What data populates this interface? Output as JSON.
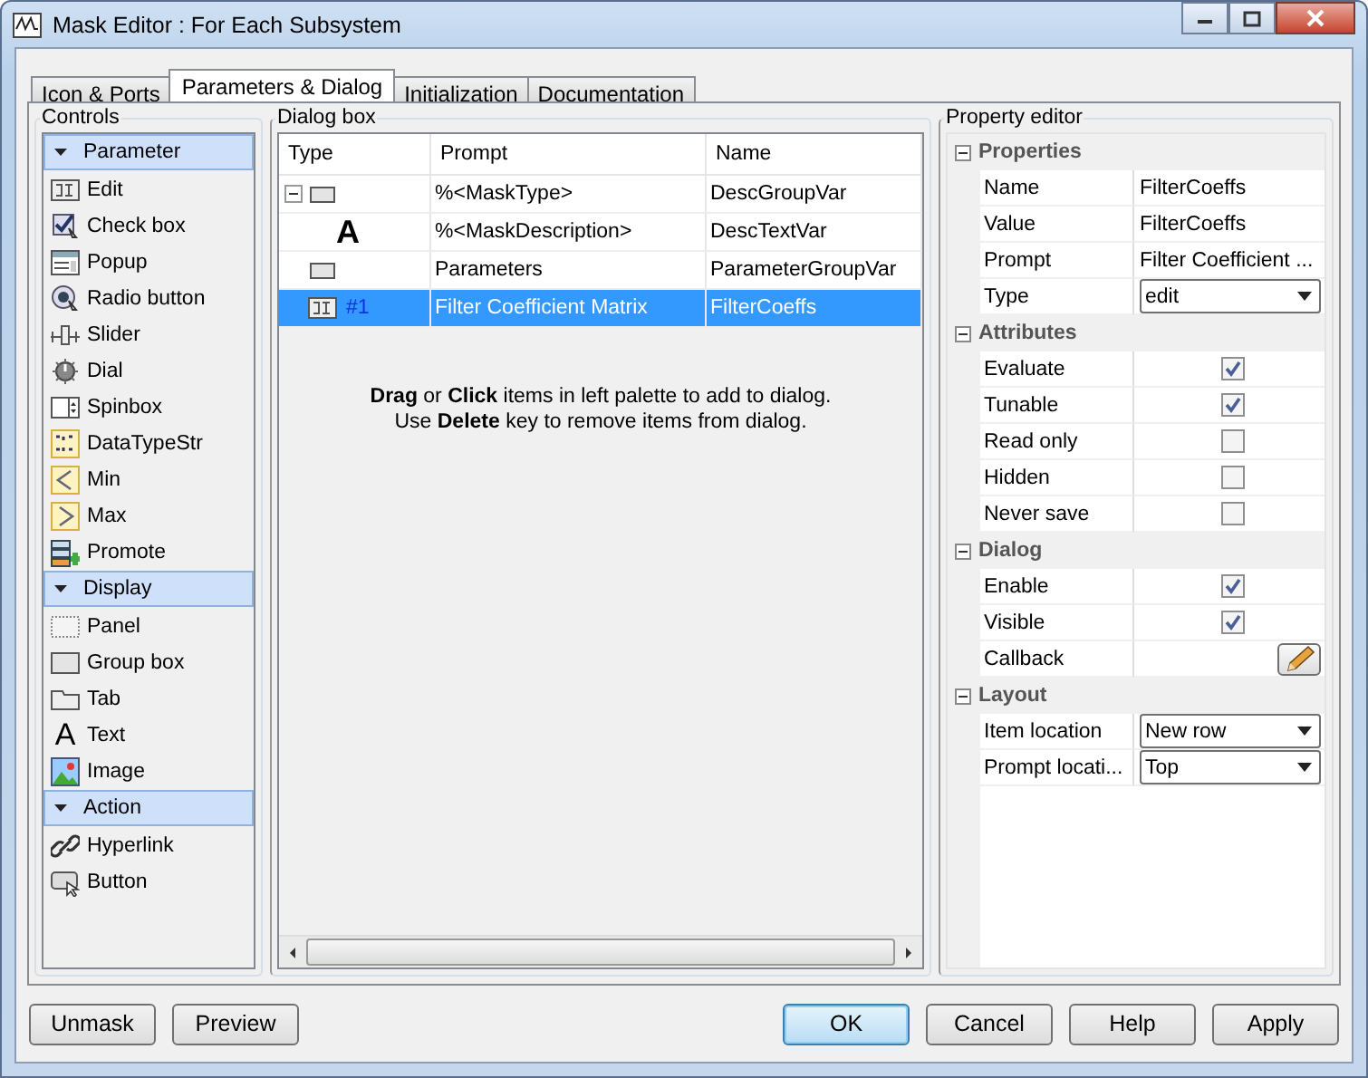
{
  "window": {
    "title": "Mask Editor : For Each Subsystem"
  },
  "tabs": [
    {
      "label": "Icon & Ports",
      "selected": false
    },
    {
      "label": "Parameters & Dialog",
      "selected": true
    },
    {
      "label": "Initialization",
      "selected": false
    },
    {
      "label": "Documentation",
      "selected": false
    }
  ],
  "controls": {
    "title": "Controls",
    "groups": [
      {
        "label": "Parameter",
        "expanded": true,
        "items": [
          {
            "label": "Edit"
          },
          {
            "label": "Check box"
          },
          {
            "label": "Popup"
          },
          {
            "label": "Radio button"
          },
          {
            "label": "Slider"
          },
          {
            "label": "Dial"
          },
          {
            "label": "Spinbox"
          },
          {
            "label": "DataTypeStr"
          },
          {
            "label": "Min"
          },
          {
            "label": "Max"
          },
          {
            "label": "Promote"
          }
        ]
      },
      {
        "label": "Display",
        "expanded": true,
        "items": [
          {
            "label": "Panel"
          },
          {
            "label": "Group box"
          },
          {
            "label": "Tab"
          },
          {
            "label": "Text",
            "glyph": "A"
          },
          {
            "label": "Image"
          }
        ]
      },
      {
        "label": "Action",
        "expanded": true,
        "items": [
          {
            "label": "Hyperlink"
          },
          {
            "label": "Button"
          }
        ]
      }
    ]
  },
  "dialog_box": {
    "title": "Dialog box",
    "columns": [
      "Type",
      "Prompt",
      "Name"
    ],
    "rows": [
      {
        "kind": "group",
        "expanded": true,
        "prompt": "%<MaskType>",
        "name": "DescGroupVar",
        "selected": false,
        "children": [
          {
            "kind": "text",
            "glyph": "A",
            "prompt": "%<MaskDescription>",
            "name": "DescTextVar",
            "selected": false
          }
        ]
      },
      {
        "kind": "group",
        "prompt": "Parameters",
        "name": "ParameterGroupVar",
        "selected": false
      },
      {
        "kind": "edit",
        "type_label": "#1",
        "prompt": "Filter Coefficient Matrix",
        "name": "FilterCoeffs",
        "selected": true
      }
    ],
    "hint": [
      "**Drag** or **Click** items in left palette to add to dialog.",
      "Use **Delete** key to remove items from dialog."
    ]
  },
  "property_editor": {
    "title": "Property editor",
    "sections": [
      {
        "label": "Properties",
        "expanded": true,
        "rows": [
          {
            "kind": "text",
            "label": "Name",
            "value": "FilterCoeffs"
          },
          {
            "kind": "text",
            "label": "Value",
            "value": "FilterCoeffs"
          },
          {
            "kind": "text",
            "label": "Prompt",
            "value": "Filter Coefficient ..."
          },
          {
            "kind": "dropdown",
            "label": "Type",
            "value": "edit"
          }
        ]
      },
      {
        "label": "Attributes",
        "expanded": true,
        "rows": [
          {
            "kind": "checkbox",
            "label": "Evaluate",
            "checked": true
          },
          {
            "kind": "checkbox",
            "label": "Tunable",
            "checked": true
          },
          {
            "kind": "checkbox",
            "label": "Read only",
            "checked": false
          },
          {
            "kind": "checkbox",
            "label": "Hidden",
            "checked": false
          },
          {
            "kind": "checkbox",
            "label": "Never save",
            "checked": false
          }
        ]
      },
      {
        "label": "Dialog",
        "expanded": true,
        "rows": [
          {
            "kind": "checkbox",
            "label": "Enable",
            "checked": true
          },
          {
            "kind": "checkbox",
            "label": "Visible",
            "checked": true
          },
          {
            "kind": "button",
            "label": "Callback"
          }
        ]
      },
      {
        "label": "Layout",
        "expanded": true,
        "rows": [
          {
            "kind": "dropdown",
            "label": "Item location",
            "value": "New row"
          },
          {
            "kind": "dropdown",
            "label": "Prompt locati...",
            "value": "Top"
          }
        ]
      }
    ]
  },
  "left_buttons": [
    {
      "label": "Unmask",
      "default": false
    },
    {
      "label": "Preview",
      "default": false
    }
  ],
  "right_buttons": [
    {
      "label": "OK",
      "default": true
    },
    {
      "label": "Cancel",
      "default": false
    },
    {
      "label": "Help",
      "default": false
    },
    {
      "label": "Apply",
      "default": false
    }
  ]
}
